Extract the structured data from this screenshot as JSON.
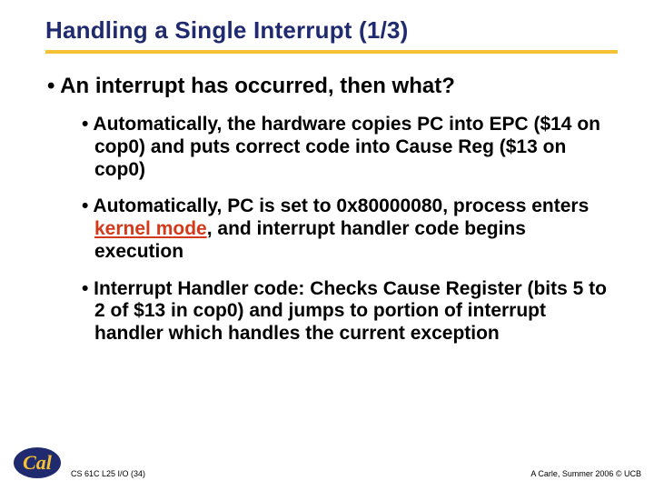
{
  "title": "Handling a Single Interrupt (1/3)",
  "main": "• An interrupt has occurred, then what?",
  "sub1": "• Automatically, the hardware copies PC into EPC ($14 on cop0) and puts correct code into Cause Reg ($13 on cop0)",
  "sub2_a": "• Automatically, PC is set to 0x80000080, process enters ",
  "sub2_hl": "kernel mode",
  "sub2_b": ", and interrupt handler code begins execution",
  "sub3": "• Interrupt Handler code: Checks Cause Register (bits 5 to 2 of $13 in cop0) and jumps to portion of interrupt handler which handles the current exception",
  "footer_left": "CS 61C L25 I/O (34)",
  "footer_right": "A Carle, Summer 2006 © UCB"
}
